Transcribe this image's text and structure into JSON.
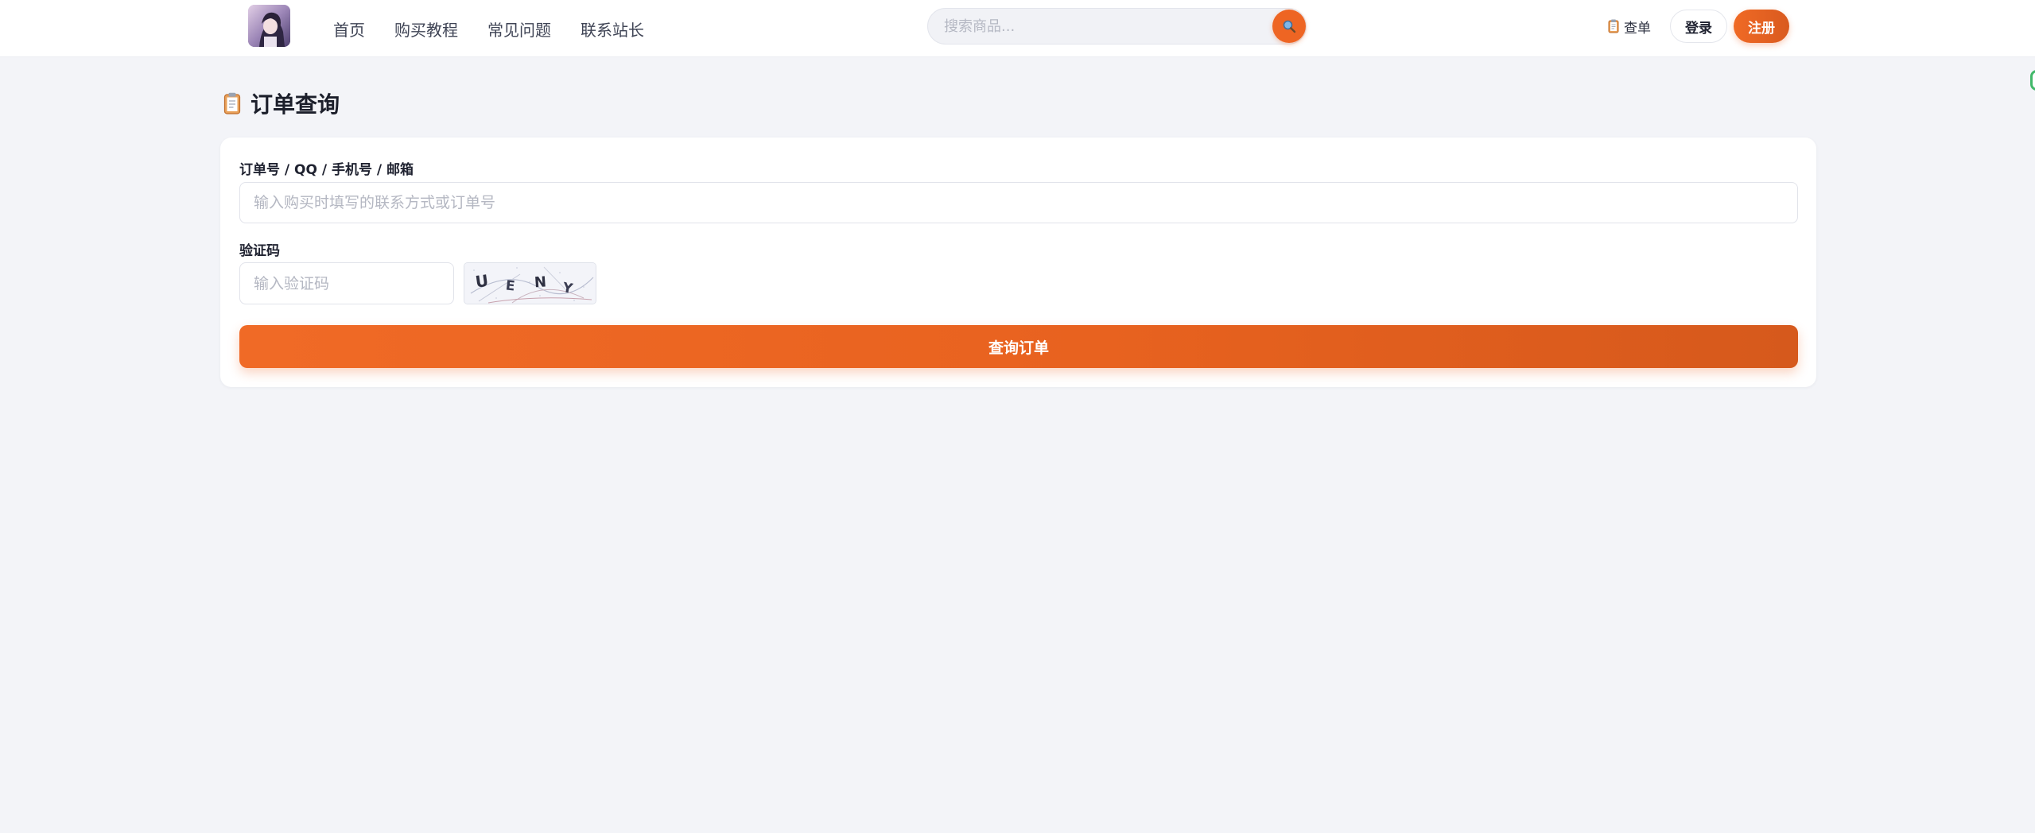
{
  "header": {
    "nav": [
      "首页",
      "购买教程",
      "常见问题",
      "联系站长"
    ],
    "search": {
      "placeholder": "搜索商品..."
    },
    "order_link": "查单",
    "login": "登录",
    "register": "注册"
  },
  "page": {
    "title": "订单查询"
  },
  "form": {
    "query_label": "订单号 / QQ / 手机号 / 邮箱",
    "query_placeholder": "输入购买时填写的联系方式或订单号",
    "captcha_label": "验证码",
    "captcha_placeholder": "输入验证码",
    "captcha_text": [
      "U",
      "E",
      "N",
      "Y"
    ],
    "submit": "查询订单"
  },
  "colors": {
    "accent": "#ee6523",
    "background": "#f3f4f8",
    "card": "#ffffff"
  },
  "icons": {
    "search_button": "search-icon",
    "order_link": "clipboard-icon",
    "title": "clipboard-icon"
  }
}
